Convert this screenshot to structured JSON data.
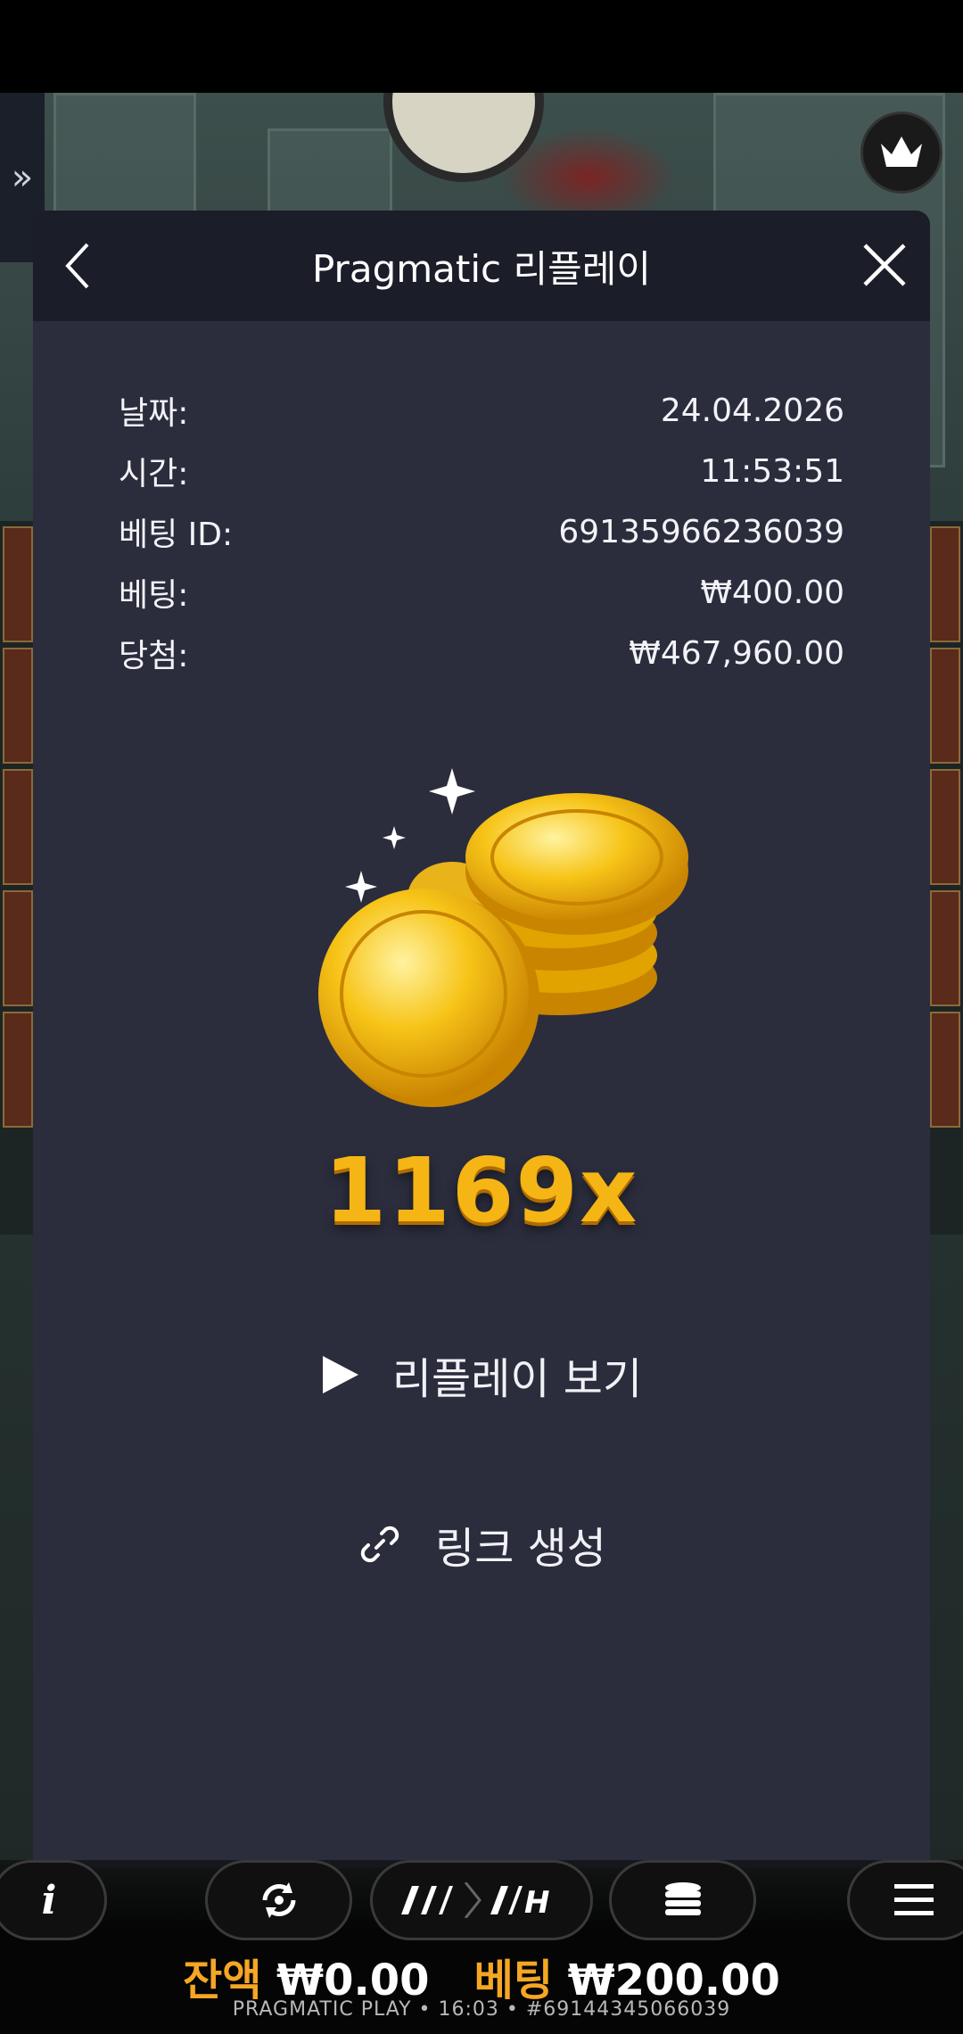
{
  "modal": {
    "title": "Pragmatic 리플레이",
    "details": [
      {
        "label": "날짜:",
        "value": "24.04.2026"
      },
      {
        "label": "시간:",
        "value": "11:53:51"
      },
      {
        "label": "베팅 ID:",
        "value": "69135966236039"
      },
      {
        "label": "베팅:",
        "value": "₩400.00"
      },
      {
        "label": "당첨:",
        "value": "₩467,960.00"
      }
    ],
    "multiplier": "1169x",
    "watch_replay": "리플레이 보기",
    "create_link": "링크 생성"
  },
  "game_bar": {
    "balance_label": "잔액",
    "balance_value": "₩0.00",
    "bet_label": "베팅",
    "bet_value": "₩200.00",
    "footer": "PRAGMATIC PLAY • 16:03 • #69144345066039"
  },
  "colors": {
    "modal_bg": "#2b2d3d",
    "header_bg": "#1b1d29",
    "gold": "#f5b515",
    "balance_label": "#f5a623"
  }
}
